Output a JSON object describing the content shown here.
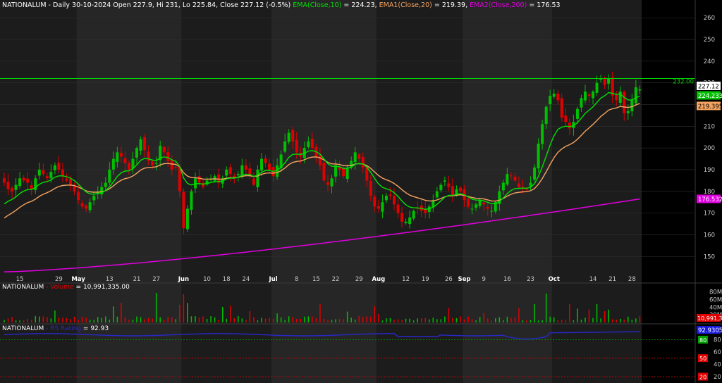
{
  "colors": {
    "background": "#000000",
    "band_dark": "#1c1c1c",
    "band_light": "#262626",
    "grid": "#2f2f2f",
    "up": "#00c000",
    "down": "#e00000",
    "ema10": "#00e000",
    "ema20": "#f4a460",
    "ema200": "#e000e0",
    "resistance": "#00d000",
    "rs": "#2828c8",
    "axis_text": "#c8c8c8"
  },
  "header": {
    "symbol": "NATIONALUM",
    "ohlc": " - Daily 30-10-2024 Open 227.9, Hi 231, Lo 225.84, Close 227.12 (-0.5%)",
    "ema10_label": " EMA(Close,10)",
    "ema10_value": " = 224.23,",
    "ema20_label": " EMA1(Close,20)",
    "ema20_value": " = 219.39,",
    "ema200_label": " EMA2(Close,200)",
    "ema200_value": " = 176.53"
  },
  "volume_header": {
    "symbol": "NATIONALUM",
    "label": " - Volume",
    "value": " = 10,991,335.00"
  },
  "rs_header": {
    "symbol": "NATIONALUM",
    "label": " - RS Rating",
    "value": " = 92.93"
  },
  "chart_data": {
    "type": "candlestick",
    "price_ylim": [
      141,
      263
    ],
    "price_ticks": [
      150,
      160,
      170,
      180,
      190,
      200,
      210,
      220,
      230,
      240,
      250,
      260
    ],
    "volume_ylim": [
      0,
      85000000
    ],
    "volume_ticks": [
      {
        "value": 20000000,
        "label": "20M"
      },
      {
        "value": 40000000,
        "label": "40M"
      },
      {
        "value": 60000000,
        "label": "60M"
      },
      {
        "value": 80000000,
        "label": "80M"
      }
    ],
    "rs_ylim": [
      12,
      101
    ],
    "rs_ticks": [
      20,
      40,
      60,
      80
    ],
    "rs_levels": [
      {
        "value": 80,
        "label": "80",
        "color": "#00a000"
      },
      {
        "value": 50,
        "label": "50",
        "color": "#e00000"
      },
      {
        "value": 20,
        "label": "20",
        "color": "#e00000"
      }
    ],
    "resistance": {
      "value": 232,
      "label": "232.00"
    },
    "last_price_label": {
      "value": 227.12,
      "label": "227.12"
    },
    "ema10_label": {
      "value": 224.23,
      "label": "224.233"
    },
    "ema20_label": {
      "value": 219.39,
      "label": "219.395"
    },
    "ema200_label": {
      "value": 176.53,
      "label": "176.532"
    },
    "volume_label": {
      "label": "10,991,33"
    },
    "rs_label": {
      "label": "92.9305"
    },
    "x_labels": [
      {
        "i": 4,
        "label": "15"
      },
      {
        "i": 14,
        "label": "29"
      },
      {
        "i": 19,
        "label": "May"
      },
      {
        "i": 27,
        "label": "13"
      },
      {
        "i": 34,
        "label": "21"
      },
      {
        "i": 39,
        "label": "27"
      },
      {
        "i": 46,
        "label": "Jun"
      },
      {
        "i": 52,
        "label": "10"
      },
      {
        "i": 57,
        "label": "18"
      },
      {
        "i": 62,
        "label": "24"
      },
      {
        "i": 69,
        "label": "Jul"
      },
      {
        "i": 75,
        "label": "8"
      },
      {
        "i": 80,
        "label": "15"
      },
      {
        "i": 85,
        "label": "22"
      },
      {
        "i": 91,
        "label": "29"
      },
      {
        "i": 96,
        "label": "Aug"
      },
      {
        "i": 103,
        "label": "12"
      },
      {
        "i": 108,
        "label": "19"
      },
      {
        "i": 114,
        "label": "26"
      },
      {
        "i": 118,
        "label": "Sep"
      },
      {
        "i": 123,
        "label": "9"
      },
      {
        "i": 129,
        "label": "16"
      },
      {
        "i": 135,
        "label": "23"
      },
      {
        "i": 141,
        "label": "Oct"
      },
      {
        "i": 151,
        "label": "14"
      },
      {
        "i": 156,
        "label": "21"
      },
      {
        "i": 161,
        "label": "28"
      }
    ],
    "month_bands": [
      {
        "from": 0,
        "to": 19
      },
      {
        "from": 19,
        "to": 46
      },
      {
        "from": 46,
        "to": 69
      },
      {
        "from": 69,
        "to": 96
      },
      {
        "from": 96,
        "to": 118
      },
      {
        "from": 118,
        "to": 141
      },
      {
        "from": 141,
        "to": 164
      }
    ],
    "close": [
      184,
      181,
      180,
      183,
      186,
      185,
      184,
      181,
      186,
      190,
      188,
      186,
      189,
      192,
      190,
      187,
      185,
      183,
      180,
      176,
      173,
      172,
      175,
      178,
      180,
      182,
      184,
      190,
      195,
      198,
      196,
      193,
      190,
      195,
      200,
      204,
      199,
      194,
      192,
      193,
      201,
      198,
      194,
      190,
      191,
      180,
      163,
      172,
      180,
      186,
      184,
      182,
      185,
      186,
      187,
      184,
      186,
      190,
      188,
      186,
      188,
      192,
      190,
      187,
      183,
      190,
      195,
      193,
      190,
      187,
      192,
      197,
      203,
      207,
      203,
      198,
      196,
      200,
      203,
      200,
      196,
      192,
      185,
      183,
      186,
      192,
      190,
      187,
      191,
      194,
      198,
      195,
      191,
      185,
      178,
      173,
      172,
      175,
      178,
      178,
      174,
      170,
      166,
      166,
      168,
      171,
      172,
      171,
      170,
      173,
      176,
      180,
      183,
      185,
      182,
      178,
      181,
      180,
      176,
      173,
      172,
      174,
      176,
      174,
      172,
      171,
      175,
      180,
      184,
      188,
      187,
      185,
      182,
      182,
      181,
      184,
      191,
      202,
      211,
      219,
      224,
      225,
      222,
      214,
      212,
      209,
      212,
      218,
      223,
      226,
      224,
      226,
      230,
      232,
      229,
      232,
      224,
      222,
      226,
      216,
      217,
      222,
      228,
      227
    ]
  }
}
